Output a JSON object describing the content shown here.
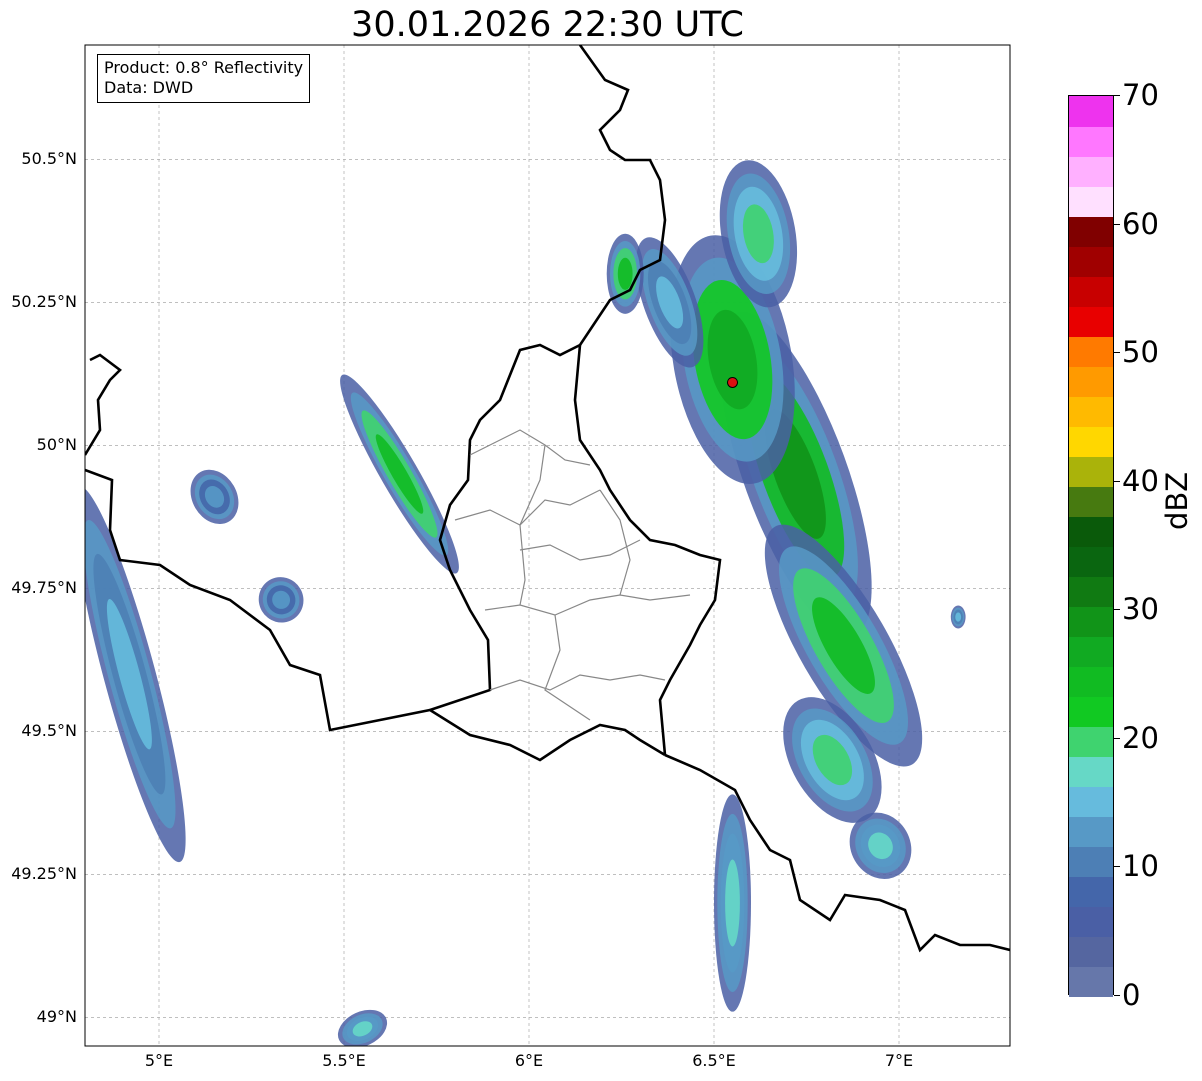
{
  "title": "30.01.2026 22:30 UTC",
  "info": {
    "product": "Product: 0.8° Reflectivity",
    "source": "Data: DWD"
  },
  "axes": {
    "lon_range": [
      4.8,
      7.3
    ],
    "lat_range": [
      48.95,
      50.7
    ],
    "lat_ticks": [
      {
        "value": 50.5,
        "label": "50.5°N"
      },
      {
        "value": 50.25,
        "label": "50.25°N"
      },
      {
        "value": 50.0,
        "label": "50°N"
      },
      {
        "value": 49.75,
        "label": "49.75°N"
      },
      {
        "value": 49.5,
        "label": "49.5°N"
      },
      {
        "value": 49.25,
        "label": "49.25°N"
      },
      {
        "value": 49.0,
        "label": "49°N"
      }
    ],
    "lon_ticks": [
      {
        "value": 5.0,
        "label": "5°E"
      },
      {
        "value": 5.5,
        "label": "5.5°E"
      },
      {
        "value": 6.0,
        "label": "6°E"
      },
      {
        "value": 6.5,
        "label": "6.5°E"
      },
      {
        "value": 7.0,
        "label": "7°E"
      }
    ],
    "grid": true
  },
  "radar_site": {
    "lon": 6.55,
    "lat": 50.11,
    "color": "#dd1111"
  },
  "colorbar": {
    "label": "dBZ",
    "min": 0,
    "max": 70,
    "step": 2.5,
    "tick_labels": [
      "0",
      "10",
      "20",
      "30",
      "40",
      "50",
      "60",
      "70"
    ],
    "tick_values": [
      0,
      10,
      20,
      30,
      40,
      50,
      60,
      70
    ],
    "colors": [
      "#6677aa",
      "#5566a0",
      "#4a5fa5",
      "#4466aa",
      "#4d7fb5",
      "#5799c6",
      "#66bbdd",
      "#66d8c6",
      "#3fd36f",
      "#11c922",
      "#11bb22",
      "#11aa22",
      "#119418",
      "#107a12",
      "#0a6610",
      "#0a5a0a",
      "#477a10",
      "#aab30a",
      "#ffd700",
      "#ffba00",
      "#ff9a00",
      "#ff7a00",
      "#e80000",
      "#c80000",
      "#a00000",
      "#800000",
      "#ffe0ff",
      "#ffb0ff",
      "#ff77ff",
      "#ee33ee"
    ]
  },
  "echoes": [
    {
      "lon": 6.72,
      "lat": 49.95,
      "rx": 0.14,
      "ry": 0.3,
      "angle": -20,
      "level": 24,
      "color_idx": 10
    },
    {
      "lon": 6.55,
      "lat": 50.15,
      "rx": 0.16,
      "ry": 0.22,
      "angle": -10,
      "level": 22,
      "color_idx": 9
    },
    {
      "lon": 6.62,
      "lat": 50.37,
      "rx": 0.1,
      "ry": 0.13,
      "angle": -10,
      "level": 15,
      "color_idx": 6
    },
    {
      "lon": 6.85,
      "lat": 49.65,
      "rx": 0.12,
      "ry": 0.24,
      "angle": -30,
      "level": 20,
      "color_idx": 8
    },
    {
      "lon": 6.82,
      "lat": 49.45,
      "rx": 0.11,
      "ry": 0.12,
      "angle": -30,
      "level": 15,
      "color_idx": 6
    },
    {
      "lon": 6.55,
      "lat": 49.2,
      "rx": 0.05,
      "ry": 0.19,
      "angle": 0,
      "level": 13,
      "color_idx": 5
    },
    {
      "lon": 6.38,
      "lat": 50.25,
      "rx": 0.07,
      "ry": 0.12,
      "angle": -20,
      "level": 12,
      "color_idx": 4
    },
    {
      "lon": 5.65,
      "lat": 49.95,
      "rx": 0.05,
      "ry": 0.2,
      "angle": -30,
      "level": 20,
      "color_idx": 8
    },
    {
      "lon": 4.92,
      "lat": 49.6,
      "rx": 0.07,
      "ry": 0.34,
      "angle": -15,
      "level": 12,
      "color_idx": 4
    },
    {
      "lon": 5.15,
      "lat": 49.91,
      "rx": 0.06,
      "ry": 0.05,
      "angle": -30,
      "level": 7,
      "color_idx": 3
    },
    {
      "lon": 5.33,
      "lat": 49.73,
      "rx": 0.06,
      "ry": 0.04,
      "angle": -30,
      "level": 7,
      "color_idx": 3
    },
    {
      "lon": 5.55,
      "lat": 48.98,
      "rx": 0.07,
      "ry": 0.03,
      "angle": -25,
      "level": 12,
      "color_idx": 5
    },
    {
      "lon": 6.26,
      "lat": 50.3,
      "rx": 0.05,
      "ry": 0.07,
      "angle": 0,
      "level": 20,
      "color_idx": 8
    },
    {
      "lon": 6.95,
      "lat": 49.3,
      "rx": 0.08,
      "ry": 0.06,
      "angle": -30,
      "level": 12,
      "color_idx": 5
    },
    {
      "lon": 7.16,
      "lat": 49.7,
      "rx": 0.02,
      "ry": 0.02,
      "angle": 0,
      "level": 10,
      "color_idx": 4
    }
  ]
}
